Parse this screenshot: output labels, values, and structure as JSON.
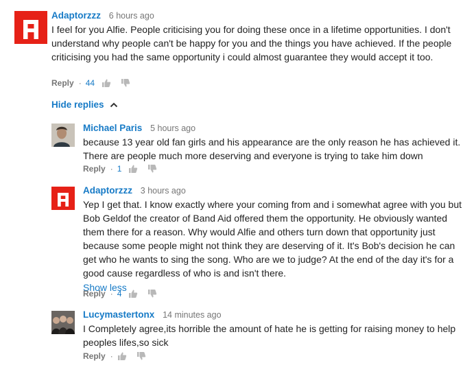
{
  "comments": [
    {
      "author": "Adaptorzzz",
      "time": "6 hours ago",
      "text": "I feel for you Alfie. People criticising you for doing these once in a lifetime opportunities. I don't understand why people can't be happy for you and the things you have achieved. If the people criticising you had the same opportunity i could almost guarantee they would accept it too.",
      "reply_label": "Reply",
      "likes": "44",
      "avatar": "red-square-logo"
    }
  ],
  "hide_replies_label": "Hide replies",
  "replies": [
    {
      "author": "Michael Paris",
      "time": "5 hours ago",
      "text": "because 13 year old fan girls and his appearance are the only reason he has achieved it. There are people much more deserving and everyone is trying to take him down",
      "reply_label": "Reply",
      "likes": "1",
      "avatar": "profile-photo"
    },
    {
      "author": "Adaptorzzz",
      "time": "3 hours ago",
      "text": "Yep I get that. I know exactly where your coming from and i somewhat agree with you but Bob Geldof the creator of Band Aid offered them the opportunity. He obviously wanted them there for a reason. Why would Alfie and others turn down that opportunity just because some people might not think they are deserving of it. It's Bob's decision he can get who he wants to sing the song. Who are we to judge? At the end of the day it's for a good cause regardless of who is and isn't there.",
      "show_less_label": "Show less",
      "reply_label": "Reply",
      "likes": "4",
      "avatar": "red-square-logo"
    },
    {
      "author": "Lucymastertonx",
      "time": "14 minutes ago",
      "text": "I Completely agree,its horrible the amount of hate he is getting for raising money to help peoples lifes,so sick",
      "reply_label": "Reply",
      "likes": "",
      "avatar": "group-photo"
    }
  ],
  "colors": {
    "link_blue": "#167ac6",
    "avatar_red": "#e62117",
    "muted_gray": "#767676",
    "text": "#222222"
  }
}
